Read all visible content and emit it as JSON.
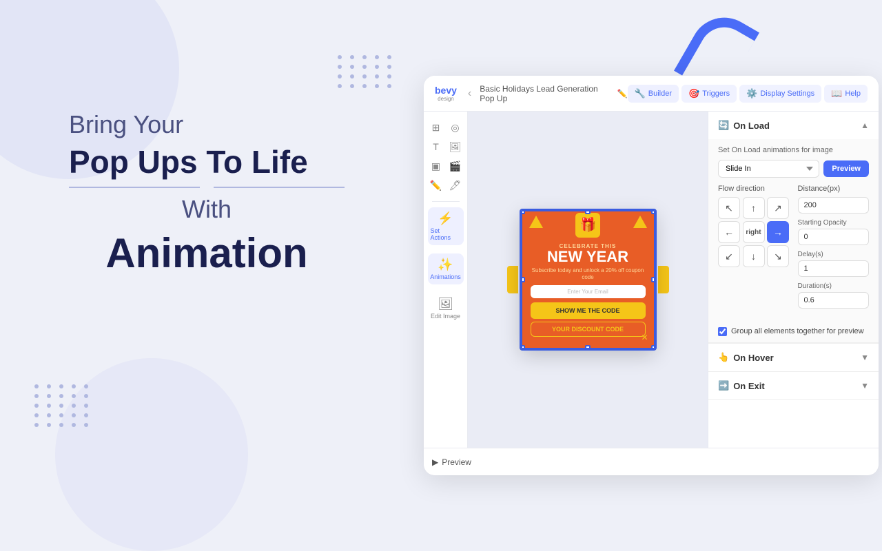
{
  "background": {
    "color": "#eef0f8"
  },
  "left_content": {
    "line1": "Bring Your",
    "line2": "Pop Ups To Life",
    "line3": "With",
    "line4": "Animation"
  },
  "top_bar": {
    "logo": "bevy",
    "logo_sub": "design",
    "project_title": "Basic Holidays Lead Generation Pop Up",
    "buttons": [
      {
        "label": "Builder",
        "icon": "🔧",
        "active": true
      },
      {
        "label": "Triggers",
        "icon": "🎯"
      },
      {
        "label": "Display Settings",
        "icon": "⚙️"
      },
      {
        "label": "Help",
        "icon": "📖"
      }
    ]
  },
  "toolbar": {
    "icons": [
      "⊞",
      "◎",
      "T",
      "🖼",
      "▣",
      "🎬",
      "✏️",
      "🖊"
    ],
    "set_actions_label": "Set Actions",
    "animations_label": "Animations",
    "edit_image_label": "Edit Image"
  },
  "animation_panel": {
    "on_load": {
      "title": "On Load",
      "subtitle": "Set On Load animations for image",
      "animation_type": "Slide In",
      "preview_btn": "Preview",
      "flow_direction": "Flow direction",
      "distance_px": "Distance(px)",
      "distance_value": "200",
      "starting_opacity": "Starting Opacity",
      "opacity_value": "0",
      "delay_label": "Delay(s)",
      "delay_value": "1",
      "duration_label": "Duration(s)",
      "duration_value": "0.6",
      "direction_buttons": [
        {
          "symbol": "↖",
          "pos": "tl"
        },
        {
          "symbol": "↑",
          "pos": "tm"
        },
        {
          "symbol": "↗",
          "pos": "tr"
        },
        {
          "symbol": "←",
          "pos": "ml"
        },
        {
          "symbol": "right",
          "pos": "center",
          "text": true
        },
        {
          "symbol": "→",
          "pos": "mr",
          "active": true
        },
        {
          "symbol": "↙",
          "pos": "bl"
        },
        {
          "symbol": "↓",
          "pos": "bm"
        },
        {
          "symbol": "↘",
          "pos": "br"
        }
      ],
      "group_checkbox_label": "Group all elements together for preview",
      "group_checked": true
    },
    "on_hover": {
      "title": "On Hover"
    },
    "on_exit": {
      "title": "On Exit"
    }
  },
  "popup_card": {
    "celebrate_text": "CELEBRATE THIS",
    "new_year_text": "NEW YEAR",
    "subtitle": "Subscribe today and unlock a 20% off coupon code",
    "email_placeholder": "Enter Your Email",
    "cta_button": "SHOW ME THE CODE",
    "discount_button": "YOUR DISCOUNT CODE",
    "gift_icon": "🎁"
  },
  "bottom_bar": {
    "preview_label": "Preview"
  }
}
